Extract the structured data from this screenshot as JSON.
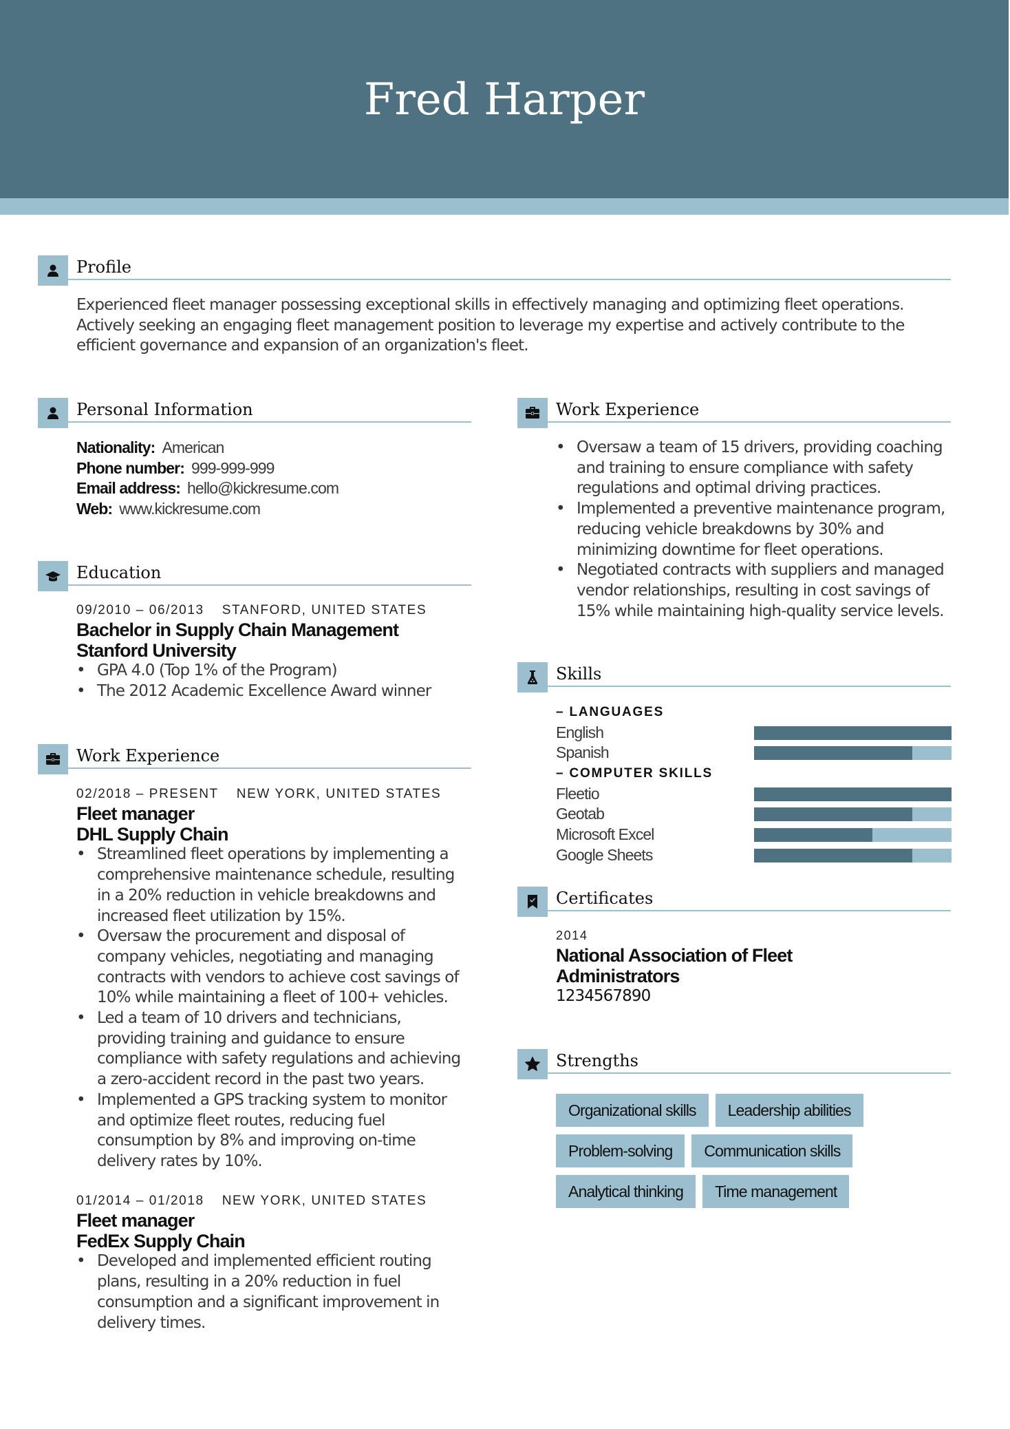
{
  "header": {
    "name": "Fred Harper"
  },
  "colors": {
    "primary": "#4f7282",
    "accent": "#9cbfcf"
  },
  "profile": {
    "title": "Profile",
    "icon": "person-icon",
    "lines": [
      "Experienced fleet manager possessing exceptional skills in effectively managing and optimizing fleet operations.",
      "Actively seeking an engaging fleet management position to leverage my expertise and actively contribute to the",
      "efficient governance and expansion of an organization's fleet."
    ]
  },
  "personal": {
    "title": "Personal Information",
    "icon": "person-icon",
    "rows": [
      {
        "label": "Nationality:",
        "value": "American"
      },
      {
        "label": "Phone number:",
        "value": "999-999-999"
      },
      {
        "label": "Email address:",
        "value": "hello@kickresume.com"
      },
      {
        "label": "Web:",
        "value": "www.kickresume.com"
      }
    ]
  },
  "education": {
    "title": "Education",
    "icon": "graduation-cap-icon",
    "items": [
      {
        "dates": "09/2010 – 06/2013",
        "location": "STANFORD, UNITED STATES",
        "degree": "Bachelor in Supply Chain Management",
        "school": "Stanford University",
        "bullets": [
          "GPA 4.0 (Top 1% of the Program)",
          "The 2012 Academic Excellence Award winner"
        ]
      }
    ]
  },
  "work_left": {
    "title": "Work Experience",
    "icon": "briefcase-icon",
    "jobs": [
      {
        "dates": "02/2018 – PRESENT",
        "location": "NEW YORK, UNITED STATES",
        "role": "Fleet manager",
        "company": "DHL Supply Chain",
        "bullets": [
          [
            "Streamlined fleet operations by implementing a",
            "comprehensive maintenance schedule, resulting",
            "in a 20% reduction in vehicle breakdowns and",
            "increased fleet utilization by 15%."
          ],
          [
            "Oversaw the procurement and disposal of",
            "company vehicles, negotiating and managing",
            "contracts with vendors to achieve cost savings of",
            "10% while maintaining a fleet of 100+ vehicles."
          ],
          [
            "Led a team of 10 drivers and technicians,",
            "providing training and guidance to ensure",
            "compliance with safety regulations and achieving",
            "a zero-accident record in the past two years."
          ],
          [
            "Implemented a GPS tracking system to monitor",
            "and optimize fleet routes, reducing fuel",
            "consumption by 8% and improving on-time",
            "delivery rates by 10%."
          ]
        ]
      },
      {
        "dates": "01/2014 – 01/2018",
        "location": "NEW YORK, UNITED STATES",
        "role": "Fleet manager",
        "company": "FedEx Supply Chain",
        "bullets": [
          [
            "Developed and implemented efficient routing",
            "plans, resulting in a 20% reduction in fuel",
            "consumption and a significant improvement in",
            "delivery times."
          ]
        ]
      }
    ]
  },
  "work_right": {
    "title": "Work Experience",
    "icon": "briefcase-icon",
    "bullets": [
      [
        "Oversaw a team of 15 drivers, providing coaching",
        "and training to ensure compliance with safety",
        "regulations and optimal driving practices."
      ],
      [
        "Implemented a preventive maintenance program,",
        "reducing vehicle breakdowns by 30% and",
        "minimizing downtime for fleet operations."
      ],
      [
        "Negotiated contracts with suppliers and managed",
        "vendor relationships, resulting in cost savings of",
        "15% while maintaining high-quality service levels."
      ]
    ]
  },
  "skills": {
    "title": "Skills",
    "icon": "flask-icon",
    "groups": [
      {
        "name": "– LANGUAGES",
        "items": [
          {
            "name": "English",
            "level": 1.0
          },
          {
            "name": "Spanish",
            "level": 0.8
          }
        ]
      },
      {
        "name": "– COMPUTER SKILLS",
        "items": [
          {
            "name": "Fleetio",
            "level": 1.0
          },
          {
            "name": "Geotab",
            "level": 0.8
          },
          {
            "name": "Microsoft Excel",
            "level": 0.6
          },
          {
            "name": "Google Sheets",
            "level": 0.8
          }
        ]
      }
    ]
  },
  "certificates": {
    "title": "Certificates",
    "icon": "bookmark-check-icon",
    "items": [
      {
        "year": "2014",
        "name_lines": [
          "National Association of Fleet",
          "Administrators"
        ],
        "id": "1234567890"
      }
    ]
  },
  "strengths": {
    "title": "Strengths",
    "icon": "star-icon",
    "tags": [
      "Organizational skills",
      "Leadership abilities",
      "Problem-solving",
      "Communication skills",
      "Analytical thinking",
      "Time management"
    ]
  }
}
